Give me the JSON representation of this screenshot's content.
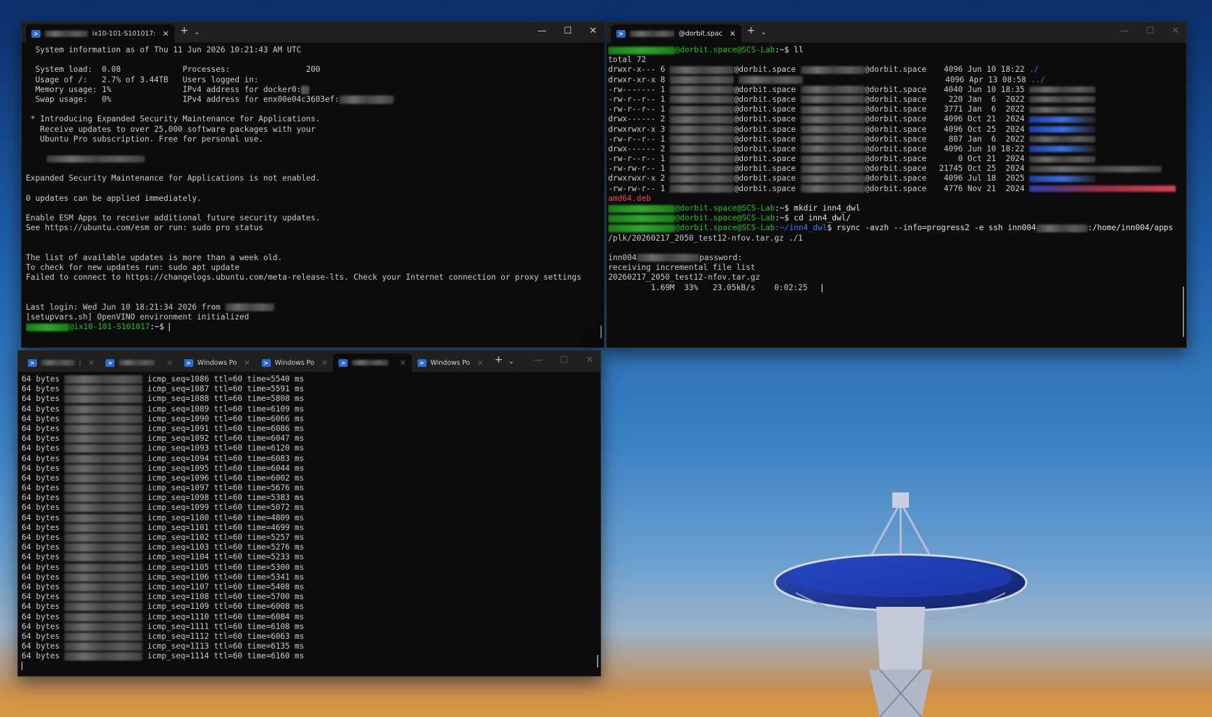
{
  "win_tl": {
    "tab_title": "ix10-101-S101017:",
    "lines": [
      "  System information as of Thu 11 Jun 2026 10:21:43 AM UTC",
      "",
      "  System load:  0.08             Processes:                200",
      "  Usage of /:   2.7% of 3.44TB   Users logged in:",
      "  Memory usage: 1%               IPv4 address for docker0:",
      "  Swap usage:   0%               IPv4 address for enx00e04c3603ef:",
      "",
      " * Introducing Expanded Security Maintenance for Applications.",
      "   Receive updates to over 25,000 software packages with your",
      "   Ubuntu Pro subscription. Free for personal use.",
      "",
      "",
      "",
      "Expanded Security Maintenance for Applications is not enabled.",
      "",
      "0 updates can be applied immediately.",
      "",
      "Enable ESM Apps to receive additional future security updates.",
      "See https://ubuntu.com/esm or run: sudo pro status",
      "",
      "",
      "The list of available updates is more than a week old.",
      "To check for new updates run: sudo apt update",
      "Failed to connect to https://changelogs.ubuntu.com/meta-release-lts. Check your Internet connection or proxy settings",
      "",
      "",
      "Last login: Wed Jun 10 18:21:34 2026 from",
      "[setupvars.sh] OpenVINO environment initialized"
    ],
    "prompt_host": "@ix10-101-S101017",
    "prompt_path": ":~$"
  },
  "win_tr": {
    "tab_title": "@dorbit.spac",
    "prompt_host": "@dorbit.space@SCS-Lab",
    "cmd_ll": "ll",
    "total": "total 72",
    "ls_rows": [
      {
        "perm": "drwxr-x--- 6",
        "owner": "@dorbit.space",
        "group": "@dorbit.space",
        "size": "4096",
        "date": "Jun 10 18:22",
        "name": "./",
        "name_color": "b"
      },
      {
        "perm": "drwxr-xr-x 8",
        "owner": "",
        "group": "",
        "size": "4096",
        "date": "Apr 13 08:58",
        "name": "../",
        "name_color": "b"
      },
      {
        "perm": "-rw------- 1",
        "owner": "@dorbit.space",
        "group": "@dorbit.space",
        "size": "4040",
        "date": "Jun 10 18:35",
        "name": "",
        "name_color": ""
      },
      {
        "perm": "-rw-r--r-- 1",
        "owner": "@dorbit.space",
        "group": "@dorbit.space",
        "size": "220",
        "date": "Jan  6  2022",
        "name": "",
        "name_color": ""
      },
      {
        "perm": "-rw-r--r-- 1",
        "owner": "@dorbit.space",
        "group": "@dorbit.space",
        "size": "3771",
        "date": "Jan  6  2022",
        "name": "",
        "name_color": ""
      },
      {
        "perm": "drwx------ 2",
        "owner": "@dorbit.space",
        "group": "@dorbit.space",
        "size": "4096",
        "date": "Oct 21  2024",
        "name": "",
        "name_color": "b"
      },
      {
        "perm": "drwxrwxr-x 3",
        "owner": "@dorbit.space",
        "group": "@dorbit.space",
        "size": "4096",
        "date": "Oct 25  2024",
        "name": "",
        "name_color": "b"
      },
      {
        "perm": "-rw-r--r-- 1",
        "owner": "@dorbit.space",
        "group": "@dorbit.space",
        "size": "807",
        "date": "Jan  6  2022",
        "name": "",
        "name_color": ""
      },
      {
        "perm": "drwx------ 2",
        "owner": "@dorbit.space",
        "group": "@dorbit.space",
        "size": "4096",
        "date": "Jun 10 18:22",
        "name": "",
        "name_color": "b"
      },
      {
        "perm": "-rw-r--r-- 1",
        "owner": "@dorbit.space",
        "group": "@dorbit.space",
        "size": "0",
        "date": "Oct 21  2024",
        "name": "",
        "name_color": ""
      },
      {
        "perm": "-rw-rw-r-- 1",
        "owner": "@dorbit.space",
        "group": "@dorbit.space",
        "size": "21745",
        "date": "Oct 25  2024",
        "name": "",
        "name_color": ""
      },
      {
        "perm": "drwxrwxr-x 2",
        "owner": "@dorbit.space",
        "group": "@dorbit.space",
        "size": "4096",
        "date": "Jul 18  2025",
        "name": "",
        "name_color": "b"
      },
      {
        "perm": "-rw-rw-r-- 1",
        "owner": "@dorbit.space",
        "group": "@dorbit.space",
        "size": "4776",
        "date": "Nov 21  2024",
        "name": "",
        "name_color": "r"
      }
    ],
    "deb_name": "amd64.deb",
    "path_home": ":~$",
    "cmd_mkdir": "mkdir inn4_dwl",
    "cmd_cd": "cd inn4_dwl/",
    "path_dir": ":~/inn4_dwl",
    "cmd_rsync": "rsync -avzh --info=progress2 -e ssh inn004",
    "cmd_rsync_tail": ":/home/inn004/apps",
    "rsync_cont": "/plk/20260217_2050_test12-nfov.tar.gz ./1",
    "pw_user": "inn004",
    "pw_prompt": "password:",
    "recv_msg": "receiving incremental file list",
    "file_name": "20260217_2050_test12-nfov.tar.gz",
    "progress_line": "         1.69M  33%   23.05kB/s    0:02:25"
  },
  "win_bl": {
    "tabs": [
      {
        "label": ":",
        "blur": true,
        "active": false
      },
      {
        "label": "",
        "blur": true,
        "active": false
      },
      {
        "label": "Windows Po",
        "blur": false,
        "active": false
      },
      {
        "label": "Windows Po",
        "blur": false,
        "active": false
      },
      {
        "label": "",
        "blur": true,
        "active": true
      },
      {
        "label": "Windows Po",
        "blur": false,
        "active": false
      }
    ],
    "ping_prefix": "64 bytes",
    "ping_rows": [
      {
        "seq": "1086",
        "time": "5540"
      },
      {
        "seq": "1087",
        "time": "5591"
      },
      {
        "seq": "1088",
        "time": "5808"
      },
      {
        "seq": "1089",
        "time": "6109"
      },
      {
        "seq": "1090",
        "time": "6066"
      },
      {
        "seq": "1091",
        "time": "6086"
      },
      {
        "seq": "1092",
        "time": "6047"
      },
      {
        "seq": "1093",
        "time": "6120"
      },
      {
        "seq": "1094",
        "time": "6083"
      },
      {
        "seq": "1095",
        "time": "6044"
      },
      {
        "seq": "1096",
        "time": "6002"
      },
      {
        "seq": "1097",
        "time": "5676"
      },
      {
        "seq": "1098",
        "time": "5383"
      },
      {
        "seq": "1099",
        "time": "5072"
      },
      {
        "seq": "1100",
        "time": "4809"
      },
      {
        "seq": "1101",
        "time": "4699"
      },
      {
        "seq": "1102",
        "time": "5257"
      },
      {
        "seq": "1103",
        "time": "5276"
      },
      {
        "seq": "1104",
        "time": "5233"
      },
      {
        "seq": "1105",
        "time": "5300"
      },
      {
        "seq": "1106",
        "time": "5341"
      },
      {
        "seq": "1107",
        "time": "5408"
      },
      {
        "seq": "1108",
        "time": "5700"
      },
      {
        "seq": "1109",
        "time": "6008"
      },
      {
        "seq": "1110",
        "time": "6084"
      },
      {
        "seq": "1111",
        "time": "6108"
      },
      {
        "seq": "1112",
        "time": "6063"
      },
      {
        "seq": "1113",
        "time": "6135"
      },
      {
        "seq": "1114",
        "time": "6160"
      }
    ]
  },
  "controls": {
    "add": "+",
    "dropdown": "⌄",
    "minimize": "—",
    "maximize": "☐",
    "close": "✕",
    "tab_close": "✕"
  }
}
